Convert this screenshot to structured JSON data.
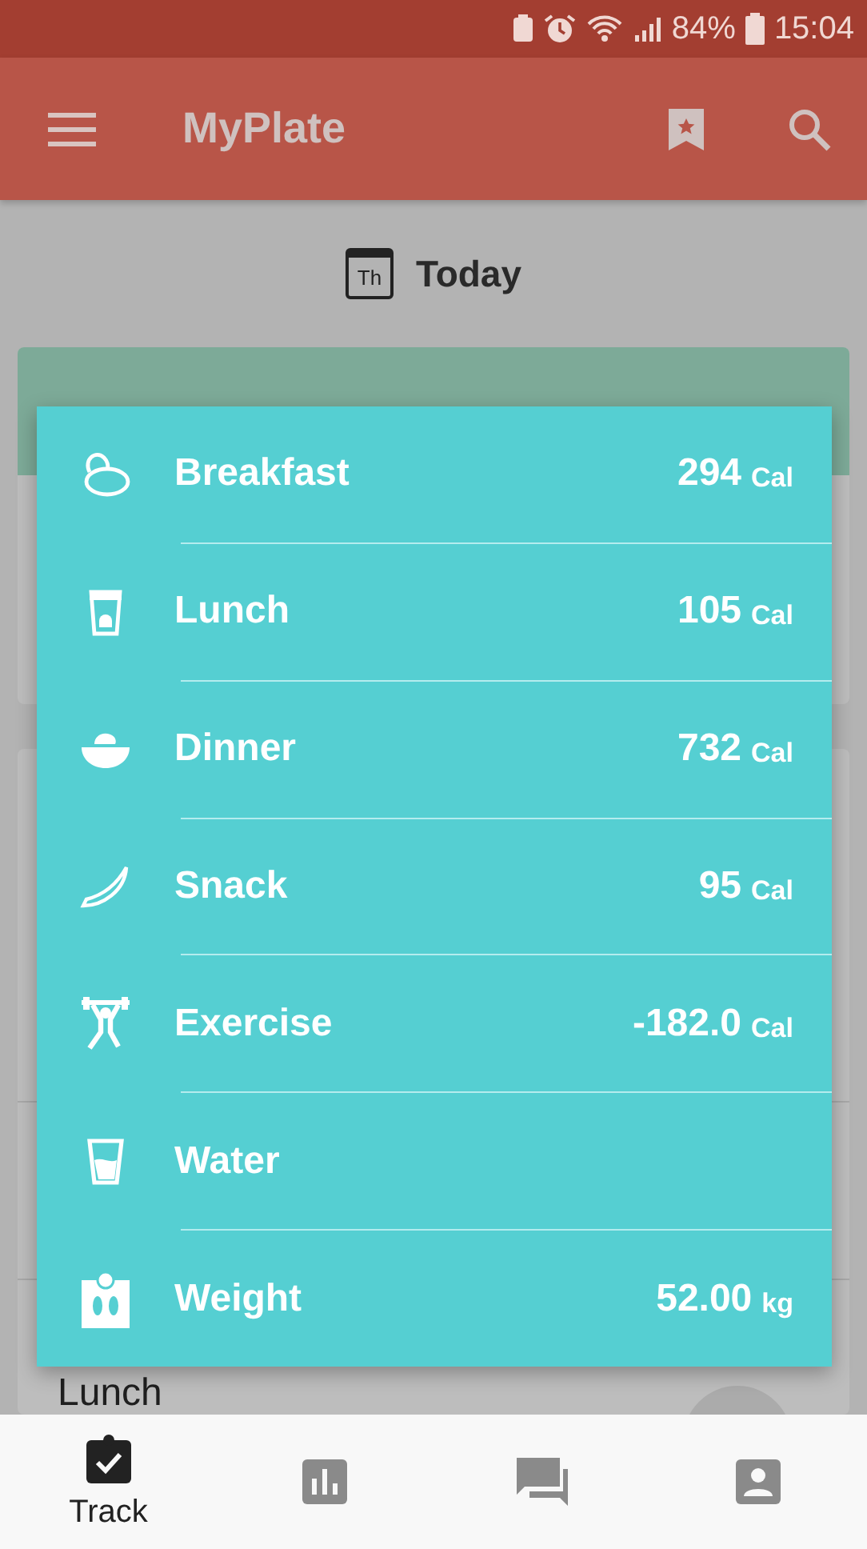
{
  "status_bar": {
    "battery": "84%",
    "time": "15:04"
  },
  "app_bar": {
    "title": "MyPlate"
  },
  "date": {
    "calendar_day": "Th",
    "label": "Today"
  },
  "background_card": {
    "row_label": "Lunch"
  },
  "dialog": {
    "items": [
      {
        "kind": "breakfast",
        "label": "Breakfast",
        "value": "294",
        "unit": "Cal"
      },
      {
        "kind": "lunch",
        "label": "Lunch",
        "value": "105",
        "unit": "Cal"
      },
      {
        "kind": "dinner",
        "label": "Dinner",
        "value": "732",
        "unit": "Cal"
      },
      {
        "kind": "snack",
        "label": "Snack",
        "value": "95",
        "unit": "Cal"
      },
      {
        "kind": "exercise",
        "label": "Exercise",
        "value": "-182.0",
        "unit": "Cal"
      },
      {
        "kind": "water",
        "label": "Water"
      },
      {
        "kind": "weight",
        "label": "Weight",
        "value": "52.00",
        "unit": "kg"
      }
    ]
  },
  "bottom_nav": [
    {
      "kind": "track",
      "label": "Track",
      "selected": true
    },
    {
      "kind": "charts",
      "selected": false
    },
    {
      "kind": "community",
      "selected": false
    },
    {
      "kind": "profile",
      "selected": false
    }
  ]
}
